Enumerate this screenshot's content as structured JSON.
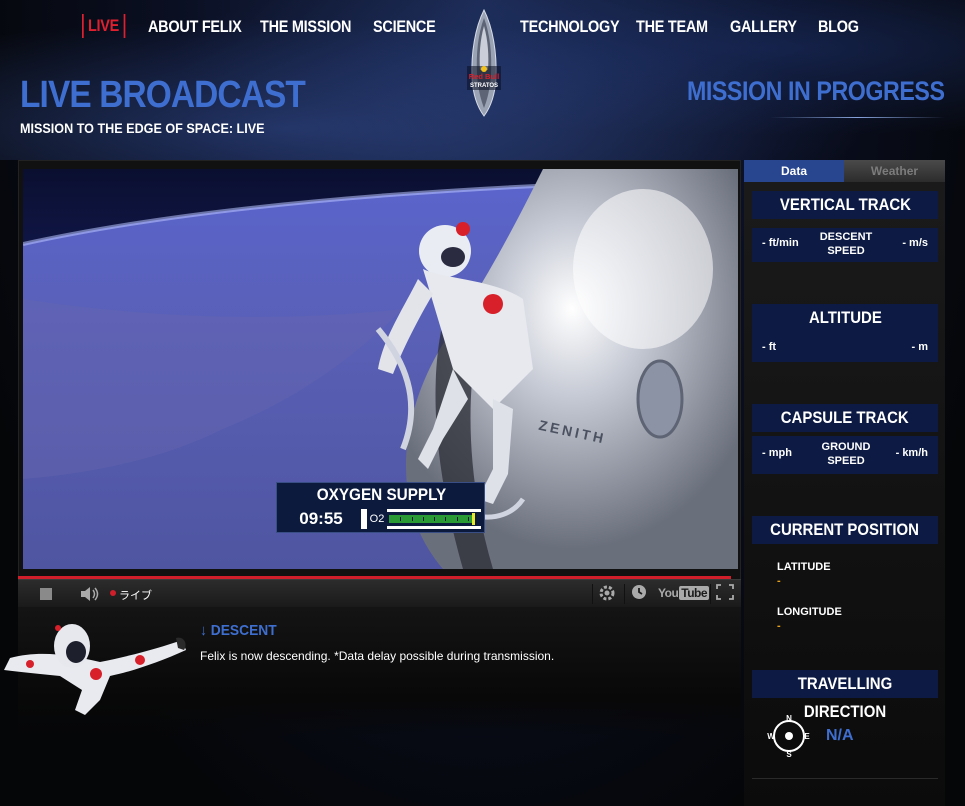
{
  "nav": {
    "live": "LIVE",
    "about": "ABOUT FELIX",
    "mission": "THE MISSION",
    "science": "SCIENCE",
    "technology": "TECHNOLOGY",
    "team": "THE TEAM",
    "gallery": "GALLERY",
    "blog": "BLOG",
    "logo_text_1": "Red Bull",
    "logo_text_2": "STRATOS"
  },
  "header": {
    "title": "LIVE BROADCAST",
    "subtitle": "MISSION TO THE EDGE OF SPACE: LIVE",
    "status": "MISSION IN PROGRESS"
  },
  "video": {
    "oxygen_title": "OXYGEN SUPPLY",
    "oxygen_time": "09:55",
    "oxygen_label": "O2",
    "oxygen_level": 0.92,
    "capsule_brand": "ZENITH",
    "live_label": "ライブ",
    "youtube_label": "You",
    "youtube_tube": "Tube"
  },
  "descent": {
    "heading": "↓ DESCENT",
    "text": "Felix is now descending. *Data delay possible during transmission."
  },
  "sidebar": {
    "tab_data": "Data",
    "tab_weather": "Weather",
    "vertical_track": {
      "title": "VERTICAL TRACK",
      "left": "- ft/min",
      "center": "DESCENT SPEED",
      "right": "- m/s"
    },
    "altitude": {
      "title": "ALTITUDE",
      "left": "- ft",
      "right": "- m"
    },
    "capsule_track": {
      "title": "CAPSULE TRACK",
      "left": "- mph",
      "center": "GROUND SPEED",
      "right": "- km/h"
    },
    "current_position": {
      "title": "CURRENT POSITION",
      "latitude_label": "LATITUDE",
      "latitude_value": "-",
      "longitude_label": "LONGITUDE",
      "longitude_value": "-"
    },
    "travelling_direction": {
      "title": "TRAVELLING DIRECTION",
      "value": "N/A",
      "n": "N",
      "e": "E",
      "s": "S",
      "w": "W"
    }
  },
  "colors": {
    "accent_blue": "#3e6fd0",
    "live_red": "#e0202e",
    "panel_navy": "#0d1b44",
    "value_orange": "#e8a21a"
  }
}
